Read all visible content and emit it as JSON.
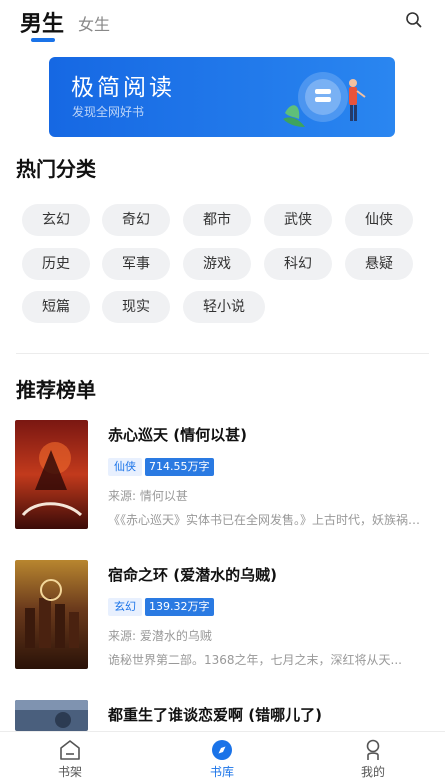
{
  "header": {
    "tabs": [
      {
        "label": "男生",
        "active": true
      },
      {
        "label": "女生",
        "active": false
      }
    ],
    "search_icon": "search-icon"
  },
  "banner": {
    "title": "极简阅读",
    "subtitle": "发现全网好书"
  },
  "categories": {
    "title": "热门分类",
    "items": [
      "玄幻",
      "奇幻",
      "都市",
      "武侠",
      "仙侠",
      "历史",
      "军事",
      "游戏",
      "科幻",
      "悬疑",
      "短篇",
      "现实",
      "轻小说"
    ]
  },
  "ranking": {
    "title": "推荐榜单",
    "books": [
      {
        "title": "赤心巡天 (情何以甚)",
        "genre": "仙侠",
        "word_count": "714.55万字",
        "source": "来源: 情何以甚",
        "description": "《《赤心巡天》实体书已在全网发售。》上古时代，妖族祸世，...",
        "cover_text": "赤心巡天"
      },
      {
        "title": "宿命之环 (爱潜水的乌贼)",
        "genre": "玄幻",
        "word_count": "139.32万字",
        "source": "来源: 爱潜水的乌贼",
        "description": "诡秘世界第二部。1368之年，七月之末，深红将从天...",
        "cover_text": "宿命之环"
      },
      {
        "title": "都重生了谁谈恋爱啊 (错哪儿了)"
      }
    ]
  },
  "bottom_nav": [
    {
      "label": "书架",
      "icon": "bookshelf-icon",
      "active": false
    },
    {
      "label": "书库",
      "icon": "compass-icon",
      "active": true
    },
    {
      "label": "我的",
      "icon": "user-icon",
      "active": false
    }
  ],
  "colors": {
    "accent": "#1a73e8",
    "chip_bg": "#f0f1f3",
    "banner_start": "#1668e3",
    "banner_end": "#2a86f0"
  }
}
